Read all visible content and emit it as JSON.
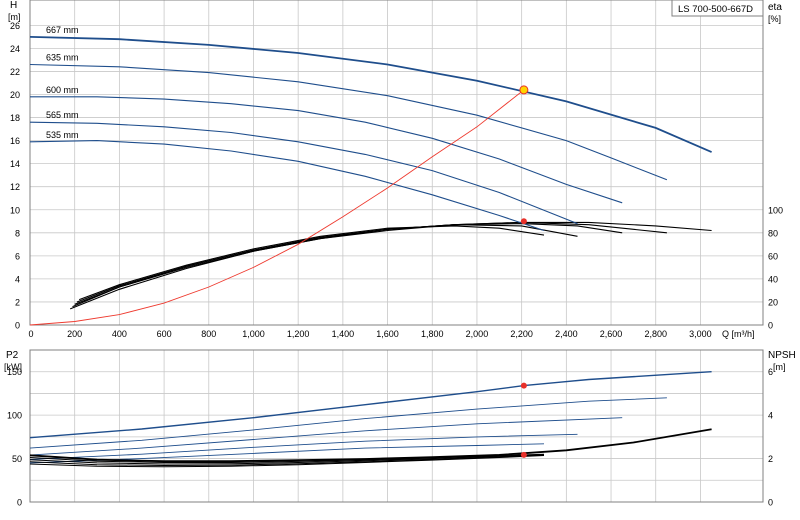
{
  "model_label": "LS 700-500-667D",
  "colors": {
    "grid": "#c8c8c8",
    "frame": "#808080",
    "curve_blue": "#1f4e8c",
    "curve_black": "#000000",
    "duty": "#e8302a",
    "duty_point_fill": "#ffd400",
    "system": "#ee3a2f"
  },
  "chart_data": [
    {
      "type": "line",
      "id": "top",
      "xlabel": "Q [m³/h]",
      "ylabel_lines": [
        "H",
        "[m]"
      ],
      "y2label_lines": [
        "eta",
        "[%]"
      ],
      "x_ticks": [
        "0",
        "200",
        "400",
        "600",
        "800",
        "1,000",
        "1,200",
        "1,400",
        "1,600",
        "1,800",
        "2,000",
        "2,200",
        "2,400",
        "2,600",
        "2,800",
        "3,000"
      ],
      "y_ticks": [
        0,
        2,
        4,
        6,
        8,
        10,
        12,
        14,
        16,
        18,
        20,
        22,
        24,
        26
      ],
      "y2_ticks": [
        0,
        20,
        40,
        60,
        80,
        100
      ],
      "xlim": [
        0,
        3280
      ],
      "ylim": [
        0,
        28.2
      ],
      "y2lim": [
        0,
        282
      ],
      "grid": true,
      "head_curves": [
        {
          "name": "667 mm",
          "x": [
            0,
            400,
            800,
            1200,
            1600,
            2000,
            2400,
            2800,
            3050
          ],
          "y": [
            25.0,
            24.8,
            24.3,
            23.6,
            22.6,
            21.2,
            19.4,
            17.1,
            15.0
          ]
        },
        {
          "name": "635 mm",
          "x": [
            0,
            400,
            800,
            1200,
            1600,
            2000,
            2400,
            2600,
            2850
          ],
          "y": [
            22.6,
            22.4,
            21.9,
            21.1,
            19.9,
            18.2,
            16.0,
            14.5,
            12.6
          ]
        },
        {
          "name": "600 mm",
          "x": [
            0,
            300,
            600,
            900,
            1200,
            1500,
            1800,
            2100,
            2400,
            2650
          ],
          "y": [
            19.8,
            19.8,
            19.6,
            19.2,
            18.6,
            17.6,
            16.2,
            14.4,
            12.2,
            10.6
          ]
        },
        {
          "name": "565 mm",
          "x": [
            0,
            300,
            600,
            900,
            1200,
            1500,
            1800,
            2100,
            2450
          ],
          "y": [
            17.6,
            17.5,
            17.2,
            16.7,
            15.9,
            14.8,
            13.4,
            11.5,
            8.8
          ]
        },
        {
          "name": "535 mm",
          "x": [
            0,
            300,
            600,
            900,
            1200,
            1500,
            1800,
            2100,
            2300
          ],
          "y": [
            15.9,
            16.0,
            15.7,
            15.1,
            14.2,
            12.9,
            11.3,
            9.5,
            8.2
          ]
        }
      ],
      "efficiency_curves": [
        {
          "x": [
            190,
            400,
            700,
            1000,
            1300,
            1600,
            1900,
            2200,
            2500,
            2800,
            3050
          ],
          "y": [
            16,
            33,
            50,
            64,
            75,
            82,
            87,
            89,
            89,
            86,
            82
          ]
        },
        {
          "x": [
            180,
            400,
            700,
            1000,
            1300,
            1600,
            1900,
            2200,
            2500,
            2850
          ],
          "y": [
            14,
            31,
            49,
            64,
            75,
            83,
            87,
            89,
            87,
            80
          ]
        },
        {
          "x": [
            200,
            400,
            700,
            1000,
            1300,
            1600,
            1900,
            2200,
            2450,
            2650
          ],
          "y": [
            18,
            33,
            51,
            65,
            76,
            83,
            87,
            88,
            86,
            80
          ]
        },
        {
          "x": [
            210,
            400,
            700,
            1000,
            1300,
            1600,
            1900,
            2200,
            2450
          ],
          "y": [
            20,
            34,
            51,
            65,
            76,
            83,
            87,
            86,
            77
          ]
        },
        {
          "x": [
            220,
            400,
            700,
            1000,
            1300,
            1600,
            1900,
            2100,
            2300
          ],
          "y": [
            22,
            35,
            52,
            66,
            77,
            84,
            86,
            84,
            78
          ]
        }
      ],
      "system_curve": {
        "x": [
          0,
          200,
          400,
          600,
          800,
          1000,
          1200,
          1400,
          1600,
          1800,
          2000,
          2210
        ],
        "y": [
          0,
          0.3,
          0.9,
          1.9,
          3.3,
          5.0,
          7.0,
          9.4,
          11.9,
          14.6,
          17.2,
          20.4
        ]
      },
      "duty_point": {
        "x": 2210,
        "y": 20.4
      },
      "eta_point": {
        "x": 2210,
        "y": 90
      }
    },
    {
      "type": "line",
      "id": "bottom",
      "ylabel_lines": [
        "P2",
        "[kW]"
      ],
      "y2label_lines": [
        "NPSH",
        "[m]"
      ],
      "xlim": [
        0,
        3280
      ],
      "ylim": [
        0,
        175
      ],
      "y2lim": [
        0,
        7
      ],
      "y_ticks": [
        0,
        50,
        100,
        150
      ],
      "y2_ticks": [
        0,
        2,
        4,
        6
      ],
      "grid": true,
      "power_curves": [
        {
          "x": [
            0,
            500,
            1000,
            1500,
            2000,
            2210,
            2500,
            3050
          ],
          "y": [
            74,
            84,
            97,
            112,
            127,
            134,
            141,
            150
          ]
        },
        {
          "x": [
            0,
            500,
            1000,
            1500,
            2000,
            2500,
            2850
          ],
          "y": [
            62,
            71,
            83,
            96,
            107,
            116,
            120
          ]
        },
        {
          "x": [
            0,
            500,
            1000,
            1500,
            2000,
            2650
          ],
          "y": [
            54,
            62,
            72,
            82,
            90,
            97
          ]
        },
        {
          "x": [
            0,
            500,
            1000,
            1500,
            2000,
            2450
          ],
          "y": [
            49,
            55,
            63,
            70,
            75,
            78
          ]
        },
        {
          "x": [
            0,
            500,
            1000,
            1500,
            2000,
            2300
          ],
          "y": [
            45,
            50,
            56,
            62,
            65,
            67
          ]
        }
      ],
      "npsh_curves": [
        {
          "x": [
            0,
            300,
            600,
            900,
            1200,
            1500,
            1800,
            2100,
            2400,
            2700,
            3050
          ],
          "y": [
            2.15,
            1.95,
            1.88,
            1.88,
            1.93,
            1.98,
            2.07,
            2.17,
            2.38,
            2.74,
            3.35
          ]
        },
        {
          "x": [
            0,
            300,
            600,
            900,
            1200,
            1500,
            1800,
            2100,
            2300
          ],
          "y": [
            2.05,
            1.88,
            1.82,
            1.82,
            1.87,
            1.94,
            2.02,
            2.13,
            2.2
          ]
        },
        {
          "x": [
            0,
            300,
            600,
            900,
            1200,
            1500,
            1800,
            2100,
            2300
          ],
          "y": [
            1.95,
            1.8,
            1.75,
            1.76,
            1.82,
            1.9,
            1.98,
            2.1,
            2.18
          ]
        },
        {
          "x": [
            0,
            300,
            600,
            900,
            1200,
            1500,
            1800,
            2100,
            2300
          ],
          "y": [
            1.85,
            1.72,
            1.68,
            1.7,
            1.76,
            1.85,
            1.95,
            2.07,
            2.16
          ]
        },
        {
          "x": [
            0,
            300,
            600,
            900,
            1200,
            1500,
            1800,
            2100,
            2300
          ],
          "y": [
            1.75,
            1.65,
            1.62,
            1.65,
            1.72,
            1.82,
            1.93,
            2.05,
            2.14
          ]
        }
      ],
      "power_point": {
        "x": 2210,
        "y": 134
      },
      "npsh_point": {
        "x": 2210,
        "y": 2.17
      }
    }
  ]
}
